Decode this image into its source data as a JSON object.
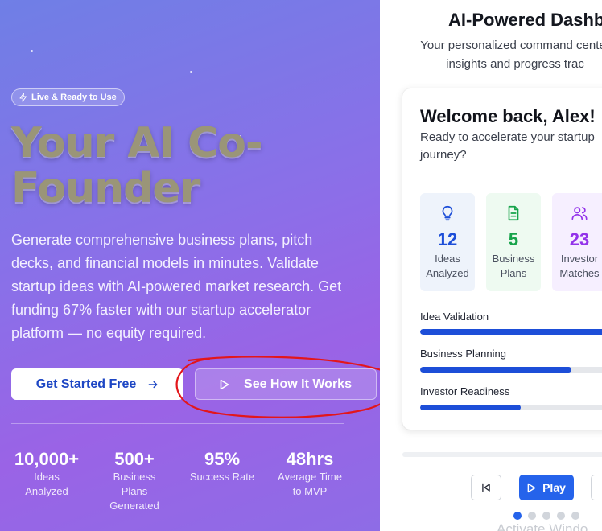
{
  "hero": {
    "badge": "Live & Ready to Use",
    "title_line1": "Your AI Co-",
    "title_line2": "Founder",
    "description": "Generate comprehensive business plans, pitch decks, and financial models in minutes. Validate startup ideas with AI-powered market research. Get funding 67% faster with our startup accelerator platform — no equity required.",
    "cta_primary": "Get Started Free",
    "cta_secondary": "See How It Works",
    "stats": [
      {
        "value": "10,000+",
        "label_lines": [
          "Ideas",
          "Analyzed"
        ]
      },
      {
        "value": "500+",
        "label_lines": [
          "Business",
          "Plans",
          "Generated"
        ]
      },
      {
        "value": "95%",
        "label_lines": [
          "Success Rate"
        ]
      },
      {
        "value": "48hrs",
        "label_lines": [
          "Average Time",
          "to MVP"
        ]
      }
    ]
  },
  "dashboard": {
    "title": "AI-Powered Dashb",
    "subtitle_line1": "Your personalized command center",
    "subtitle_line2": "insights and progress trac",
    "welcome": "Welcome back, Alex!",
    "welcome_sub": "Ready to accelerate your startup journey?",
    "metrics": [
      {
        "value": "12",
        "label_lines": [
          "Ideas",
          "Analyzed"
        ],
        "color": "#1d4ed8",
        "bg": "#eef3fb",
        "icon": "lightbulb-icon"
      },
      {
        "value": "5",
        "label_lines": [
          "Business",
          "Plans"
        ],
        "color": "#16a34a",
        "bg": "#eefaf1",
        "icon": "document-icon"
      },
      {
        "value": "23",
        "label_lines": [
          "Investor",
          "Matches"
        ],
        "color": "#9333ea",
        "bg": "#f6efff",
        "icon": "users-icon"
      }
    ],
    "progress": [
      {
        "label": "Idea Validation",
        "value": 1.0
      },
      {
        "label": "Business Planning",
        "value": 0.75
      },
      {
        "label": "Investor Readiness",
        "value": 0.5
      }
    ],
    "controls": {
      "play_label": "Play"
    },
    "watermark": "Activate Windo"
  },
  "colors": {
    "accent": "#1d4ed8",
    "annotation": "#e3161b"
  }
}
